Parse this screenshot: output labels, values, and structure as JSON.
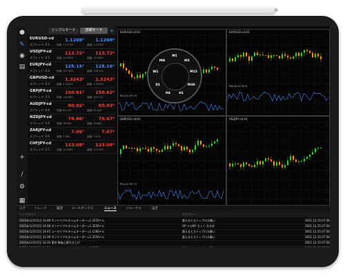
{
  "toolbar": {
    "simple_mode": "シンプルモード",
    "detail_mode": "詳細モード",
    "add": "+"
  },
  "sidebar_icons": [
    "user-icon",
    "pencil-icon",
    "chat-icon",
    "document-icon",
    "plus-icon",
    "brush-icon",
    "settings-icon",
    "grid-icon"
  ],
  "watchlist": [
    {
      "symbol": "EURUSD-cd",
      "time": "07:58:12",
      "spread": "スプレッド: 0.2",
      "bid": "1.1268⁵",
      "ask": "1.1268⁸",
      "low": "安値: 1.12718",
      "high": "高値: 1.12739",
      "dir": "up"
    },
    {
      "symbol": "USDJPY-cd",
      "time": "07:58:12",
      "spread": "スプレッド: 0.2",
      "bid": "113.72³",
      "ask": "113.72⁶",
      "low": "安値: 113.675",
      "high": "高値: 113.852",
      "dir": "down"
    },
    {
      "symbol": "EURJPY-cd",
      "time": "07:58:12",
      "spread": "スプレッド: 0.4",
      "bid": "128.16¹",
      "ask": "128.16⁵",
      "low": "安値: 127.949",
      "high": "高値: 128.274",
      "dir": "up"
    },
    {
      "symbol": "GBPUSD-cd",
      "time": "07:58:12",
      "spread": "スプレッド: 0.4",
      "bid": "1.3243¹",
      "ask": "1.3243⁵",
      "low": "安値: 1.32441",
      "high": "高値: 1.32544",
      "dir": "down"
    },
    {
      "symbol": "GBPJPY-cd",
      "time": "07:58:12",
      "spread": "スプレッド: 1.0",
      "bid": "150.61⁶",
      "ask": "150.62⁴",
      "low": "安値: 150.480",
      "high": "高値: 150.711",
      "dir": "down"
    },
    {
      "symbol": "AUDJPY-cd",
      "time": "07:58:12",
      "spread": "スプレッド: 0.6",
      "bid": "80.92⁹",
      "ask": "80.93⁵",
      "low": "安値: 80.710",
      "high": "高値: 81.041",
      "dir": "down"
    },
    {
      "symbol": "NZDJPY-cd",
      "time": "07:58:12",
      "spread": "スプレッド: 1.0",
      "bid": "76.66¹",
      "ask": "76.67¹",
      "low": "安値: 76.560",
      "high": "高値: 76.682",
      "dir": "down"
    },
    {
      "symbol": "ZARJPY-cd",
      "time": "07:57:55",
      "spread": "スプレッド: 0.6",
      "bid": "7.06⁷",
      "ask": "7.07³",
      "low": "安値: 7.061",
      "high": "高値: 7.079",
      "dir": "down"
    },
    {
      "symbol": "CHFJPY-cd",
      "time": "07:58:12",
      "spread": "スプレッド: 2.5",
      "bid": "123.08⁰",
      "ask": "123.08⁵",
      "low": "安値: 122.889",
      "high": "高値: 123.144",
      "dir": "down"
    }
  ],
  "charts": [
    {
      "title": "EURUSD-cd,H1",
      "indicator": "RSI(14) 43.19"
    },
    {
      "title": "EURUSD-cd,H1",
      "indicator": "MACD(12,26,9)"
    },
    {
      "title": "GBPUSD-cd,H1",
      "indicator": "RSI(14) 55.72"
    },
    {
      "title": "USDJPY-cd,H1",
      "indicator": ""
    }
  ],
  "timeframe_dial": {
    "labels": [
      "M1",
      "M5",
      "M15",
      "M30",
      "H1",
      "H4",
      "D1",
      "W1",
      "MN"
    ]
  },
  "tabs": [
    "ログ",
    "トレード",
    "履歴",
    "メールボックス",
    "ニュース",
    "ジャーナル",
    "設定"
  ],
  "active_tab": "ニュース",
  "news_columns": {
    "title": "ヘッドライン",
    "subject": "カテゴリー"
  },
  "news": [
    {
      "time": "2021年12月15日 14:48",
      "title": "ポンドリアルタイムオーダー=1.3250ドル",
      "subject": "超えるとストップロス買い",
      "date": "2021.12.15 07:56"
    },
    {
      "time": "2021年12月15日 14:48",
      "title": "ポンドリアルタイムオーダー=1.3250ドル",
      "subject": "OP:ドルNY カット 大きめ",
      "date": "2021.12.15 07:56"
    },
    {
      "time": "2021年12月15日 14:45",
      "title": "ユーロリアルタイムオーダー=1.1280ドル",
      "subject": "超えるとストップロス買い",
      "date": "2021.12.15 07:56"
    },
    {
      "time": "2021年12月15日 14:39",
      "title": "ポンドリアルタイムオーダー=1.3250ドル",
      "subject": "超えるとストップロス買い",
      "date": "2021.12.15 07:56"
    },
    {
      "time": "2021年12月15日 14:33",
      "title": "東京 株価上昇引き上げ",
      "subject": "",
      "date": "2021.12.15 07:56"
    },
    {
      "time": "2021年12月15日 14:29",
      "title": "ユーロリアルタイムオーダー=1.2850ドル",
      "subject": "超えるとストップロス買い",
      "date": "2021.12.15 07:56"
    },
    {
      "time": "2021年12月15日 14:27",
      "title": "ユーロリアルタイムオーダー=128.60円",
      "subject": "売り",
      "date": "2021.12.15 07:56"
    },
    {
      "time": "2021年12月15日 14:23",
      "title": "ユーロリアルタイムオーダー=1.1250ドル",
      "subject": "買い・割り込むとストップロス売り",
      "date": "2021.12.15 07:56"
    }
  ]
}
